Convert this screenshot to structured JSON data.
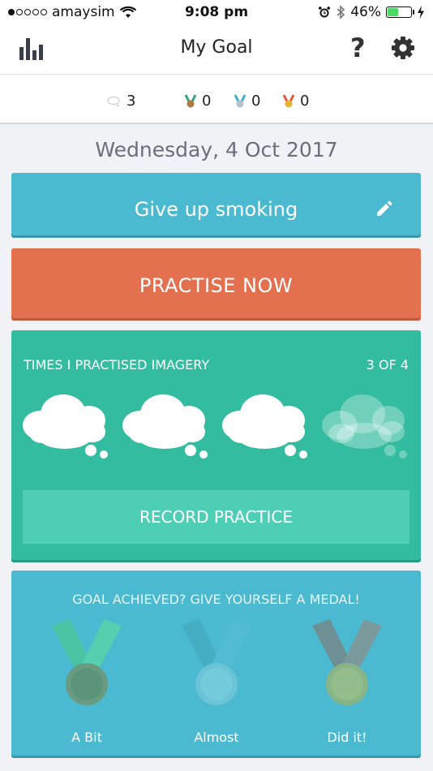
{
  "status_bar": {
    "carrier": "amaysim",
    "time": "9:08 pm",
    "battery_percent": "46%",
    "battery_level": 0.46,
    "signal_bars_filled": 1,
    "signal_bars_total": 5,
    "icons": [
      "wifi-icon",
      "alarm-icon",
      "bluetooth-icon",
      "battery-icon",
      "charging-icon"
    ]
  },
  "navbar": {
    "title": "My Goal",
    "help_label": "?",
    "left_icon": "stats-chart-icon",
    "right_icon": "gear-icon"
  },
  "counters": [
    {
      "icon": "thought-bubble-icon",
      "value": "3",
      "color": "#d0d3d8"
    },
    {
      "icon": "bronze-medal-icon",
      "value": "0",
      "color": "#a97c3e"
    },
    {
      "icon": "silver-medal-icon",
      "value": "0",
      "color": "#b7c3c7"
    },
    {
      "icon": "gold-medal-icon",
      "value": "0",
      "color": "#e6b431"
    }
  ],
  "date": "Wednesday, 4 Oct 2017",
  "goal": {
    "label": "Give up smoking",
    "edit_icon": "pencil-icon"
  },
  "practise": {
    "label": "PRACTISE NOW"
  },
  "imagery": {
    "title": "TIMES I PRACTISED IMAGERY",
    "count_label": "3 OF 4",
    "completed": 3,
    "total": 4,
    "record_label": "RECORD PRACTICE"
  },
  "medals": {
    "title": "GOAL ACHIEVED? GIVE YOURSELF A MEDAL!",
    "items": [
      {
        "label": "A Bit",
        "icon": "bronze-medal-icon"
      },
      {
        "label": "Almost",
        "icon": "silver-medal-icon"
      },
      {
        "label": "Did it!",
        "icon": "gold-medal-icon"
      }
    ]
  },
  "colors": {
    "goal_card": "#4bb9d0",
    "practise_card": "#e37150",
    "imagery_card": "#33bc9f",
    "record_button": "#4ecfb5",
    "medal_card": "#4bb9d0"
  }
}
